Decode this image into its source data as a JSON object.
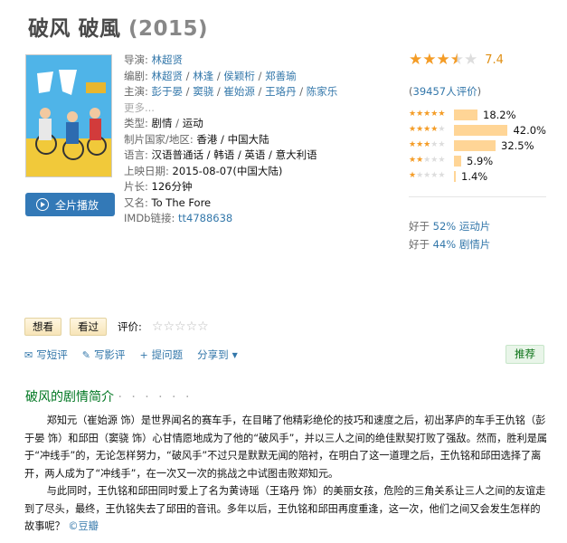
{
  "title": {
    "name": "破风 破風",
    "year": "(2015)"
  },
  "poster": {
    "alt": "破风 poster",
    "colors": {
      "sky": "#4fb4e8",
      "ground": "#f1c93a",
      "text": "#ffffff"
    }
  },
  "play_button": {
    "label": "全片播放",
    "icon": "play-circle-icon"
  },
  "info": {
    "director_label": "导演:",
    "director": "林超贤",
    "writer_label": "编剧:",
    "writers": [
      "林超贤",
      "林逢",
      "侯颖桁",
      "郑善瑜"
    ],
    "cast_label": "主演:",
    "cast": [
      "彭于晏",
      "窦骁",
      "崔始源",
      "王珞丹",
      "陈家乐"
    ],
    "cast_more": "更多...",
    "genre_label": "类型:",
    "genres": [
      "剧情",
      "运动"
    ],
    "country_label": "制片国家/地区:",
    "country": "香港 / 中国大陆",
    "language_label": "语言:",
    "language": "汉语普通话 / 韩语 / 英语 / 意大利语",
    "release_label": "上映日期:",
    "release": "2015-08-07(中国大陆)",
    "runtime_label": "片长:",
    "runtime": "126分钟",
    "aka_label": "又名:",
    "aka": "To The Fore",
    "imdb_label": "IMDb链接:",
    "imdb": "tt4788638"
  },
  "rating": {
    "score": "7.4",
    "stars_filled": 3.5,
    "votes_open": "(",
    "votes_link": "39457人评价",
    "votes_close": ")",
    "distribution": [
      {
        "stars": 5,
        "percent": 18.2,
        "label": "18.2%"
      },
      {
        "stars": 4,
        "percent": 42.0,
        "label": "42.0%"
      },
      {
        "stars": 3,
        "percent": 32.5,
        "label": "32.5%"
      },
      {
        "stars": 2,
        "percent": 5.9,
        "label": "5.9%"
      },
      {
        "stars": 1,
        "percent": 1.4,
        "label": "1.4%"
      }
    ],
    "better_than": [
      {
        "prefix": "好于 ",
        "link": "52% 运动片"
      },
      {
        "prefix": "好于 ",
        "link": "44% 剧情片"
      }
    ]
  },
  "actions": {
    "want": "想看",
    "seen": "看过",
    "rate_label": "评价:"
  },
  "toolbar": {
    "short_review": "写短评",
    "review": "写影评",
    "question": "提问题",
    "share": "分享到",
    "share_arrow": "▼",
    "recommend": "推荐"
  },
  "summary": {
    "title": "破风的剧情简介",
    "dots": "· · · · · ·",
    "p1": "郑知元（崔始源 饰）是世界闻名的赛车手，在目睹了他精彩绝伦的技巧和速度之后，初出茅庐的车手王仇铭（彭于晏 饰）和邱田（窦骁 饰）心甘情愿地成为了他的“破风手”，并以三人之间的绝佳默契打败了强敌。然而，胜利是属于“冲线手”的，无论怎样努力，“破风手”不过只是默默无闻的陪衬，在明白了这一道理之后，王仇铭和邱田选择了离开，两人成为了“冲线手”，在一次又一次的挑战之中试图击败郑知元。",
    "p2": "与此同时，王仇铭和邱田同时爱上了名为黄诗瑶（王珞丹 饰）的美丽女孩，危险的三角关系让三人之间的友谊走到了尽头，最终，王仇铭失去了邱田的音讯。多年以后，王仇铭和邱田再度重逢，这一次，他们之间又会发生怎样的故事呢？",
    "source": "©豆瓣"
  }
}
